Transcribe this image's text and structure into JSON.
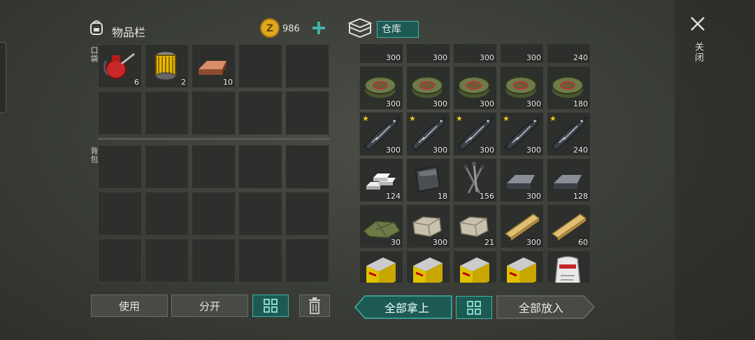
{
  "inventory": {
    "title": "物品栏",
    "coins": "986",
    "pocket_label": "口袋",
    "backpack_label": "背包",
    "pocket_items": [
      {
        "icon": "oil-can-icon",
        "qty": "6"
      },
      {
        "icon": "oil-filter-icon",
        "qty": "2"
      },
      {
        "icon": "copper-ingot-icon",
        "qty": "10"
      }
    ]
  },
  "storage": {
    "title": "仓库",
    "rows": [
      [
        {
          "icon": "grenade-icon",
          "qty": "300"
        },
        {
          "icon": "grenade-icon",
          "qty": "300"
        },
        {
          "icon": "grenade-icon",
          "qty": "300"
        },
        {
          "icon": "grenade-icon",
          "qty": "300"
        },
        {
          "icon": "grenade-icon",
          "qty": "240"
        }
      ],
      [
        {
          "icon": "landmine-icon",
          "qty": "300"
        },
        {
          "icon": "landmine-icon",
          "qty": "300"
        },
        {
          "icon": "landmine-icon",
          "qty": "300"
        },
        {
          "icon": "landmine-icon",
          "qty": "300"
        },
        {
          "icon": "landmine-icon",
          "qty": "180"
        }
      ],
      [
        {
          "icon": "sturgeon-icon",
          "qty": "300"
        },
        {
          "icon": "sturgeon-icon",
          "qty": "300"
        },
        {
          "icon": "sturgeon-icon",
          "qty": "300"
        },
        {
          "icon": "sturgeon-icon",
          "qty": "300"
        },
        {
          "icon": "sturgeon-icon",
          "qty": "240"
        }
      ],
      [
        {
          "icon": "silver-ingots-icon",
          "qty": "124"
        },
        {
          "icon": "metal-plate-icon",
          "qty": "18"
        },
        {
          "icon": "nails-icon",
          "qty": "156"
        },
        {
          "icon": "iron-ingot-icon",
          "qty": "300"
        },
        {
          "icon": "iron-ingot-icon",
          "qty": "128"
        }
      ],
      [
        {
          "icon": "cloth-icon",
          "qty": "30"
        },
        {
          "icon": "stone-icon",
          "qty": "300"
        },
        {
          "icon": "stone-icon",
          "qty": "21"
        },
        {
          "icon": "plank-icon",
          "qty": "300"
        },
        {
          "icon": "plank-icon",
          "qty": "60"
        }
      ],
      [
        {
          "icon": "battery-icon",
          "qty": ""
        },
        {
          "icon": "battery-icon",
          "qty": ""
        },
        {
          "icon": "battery-icon",
          "qty": ""
        },
        {
          "icon": "battery-icon",
          "qty": ""
        },
        {
          "icon": "cement-bag-icon",
          "qty": ""
        }
      ]
    ]
  },
  "buttons": {
    "use": "使用",
    "split": "分开",
    "take_all": "全部拿上",
    "put_all": "全部放入"
  },
  "close_label": "关闭",
  "colors": {
    "accent": "#3fb3a6",
    "coin": "#e0a820",
    "star": "#f5c518"
  }
}
